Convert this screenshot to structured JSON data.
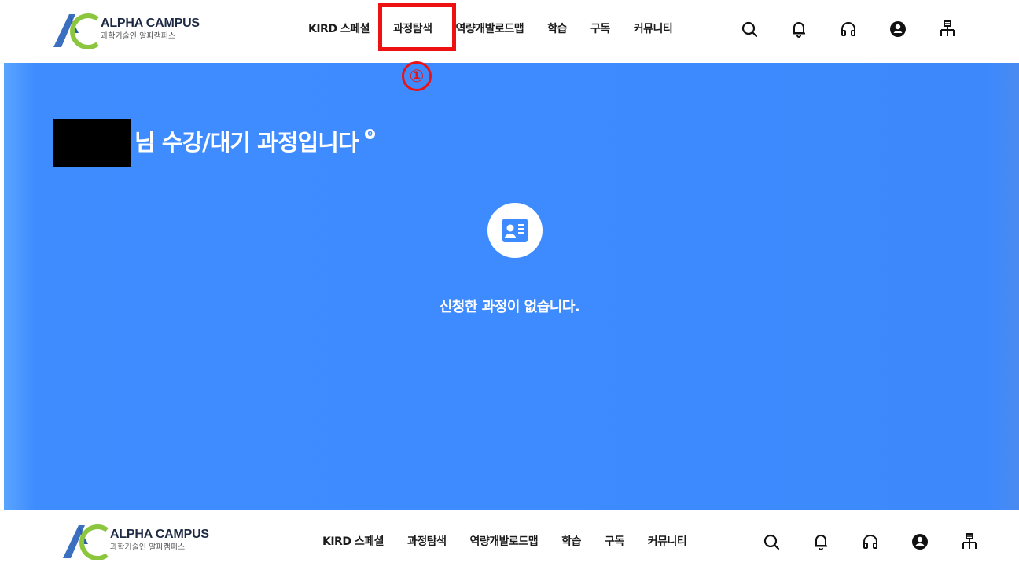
{
  "logo": {
    "title": "ALPHA CAMPUS",
    "subtitle": "과학기술인 알파캠퍼스"
  },
  "nav": {
    "items": [
      "KIRD 스페셜",
      "과정탐색",
      "역량개발로드맵",
      "학습",
      "구독",
      "커뮤니티"
    ]
  },
  "icons": [
    "search-icon",
    "bell-icon",
    "headset-icon",
    "user-icon",
    "sitemap-icon"
  ],
  "annotation": {
    "step_marker": "①",
    "highlighted_item": "과정탐색"
  },
  "hero": {
    "title_suffix": "님 수강/대기 과정입니다",
    "info_badge": "0",
    "empty_message": "신청한 과정이 없습니다."
  },
  "colors": {
    "hero_blue": "#3d8bff",
    "highlight_red": "#ee1111",
    "logo_blue": "#3b6fc0",
    "logo_green": "#8cc63f"
  }
}
